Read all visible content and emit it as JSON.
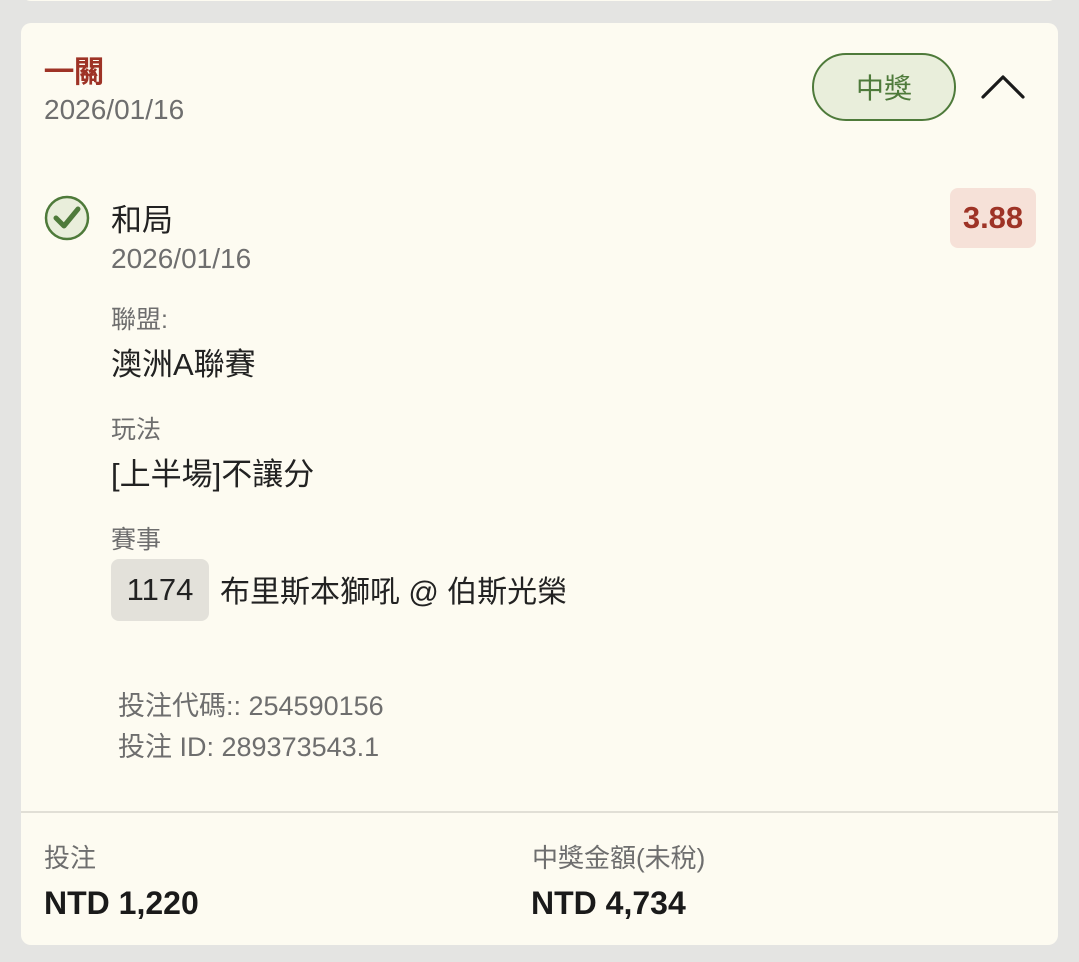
{
  "bet": {
    "type_label": "一關",
    "date": "2026/01/16",
    "status_label": "中獎",
    "colors": {
      "accent_red": "#9e3326",
      "won_green": "#4e7a3a",
      "card_bg": "#fdfbf1",
      "odds_bg": "#f6e1d8"
    }
  },
  "selection": {
    "name": "和局",
    "date": "2026/01/16",
    "odds": "3.88",
    "status_icon": "check-circle-icon",
    "league_label": "聯盟:",
    "league_value": "澳洲A聯賽",
    "market_label": "玩法",
    "market_value": "[上半場]不讓分",
    "event_label": "賽事",
    "event_code": "1174",
    "event_name": "布里斯本獅吼 @ 伯斯光榮"
  },
  "refs": {
    "code_line": "投注代碼:: 254590156",
    "id_line": "投注 ID: 289373543.1"
  },
  "footer": {
    "stake_label": "投注",
    "stake_value": "NTD 1,220",
    "payout_label": "中獎金額(未稅)",
    "payout_value": "NTD 4,734"
  },
  "icons": {
    "collapse": "chevron-up-icon"
  }
}
